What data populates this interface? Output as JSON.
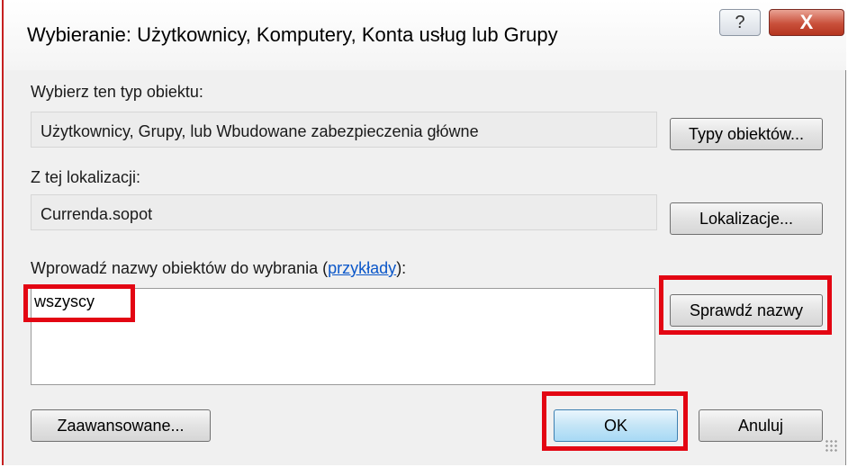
{
  "dialog": {
    "title": "Wybieranie: Użytkownicy, Komputery, Konta usług lub Grupy",
    "help_glyph": "?",
    "close_glyph": "X"
  },
  "object_type": {
    "label": "Wybierz ten typ obiektu:",
    "value": "Użytkownicy, Grupy, lub Wbudowane zabezpieczenia główne",
    "button": "Typy obiektów..."
  },
  "location": {
    "label": "Z tej lokalizacji:",
    "value": "Currenda.sopot",
    "button": "Lokalizacje..."
  },
  "names": {
    "label_prefix": "Wprowadź nazwy obiektów do wybrania (",
    "examples_link": "przykłady",
    "label_suffix": "):",
    "value": "wszyscy",
    "check_button": "Sprawdź nazwy"
  },
  "footer": {
    "advanced_button": "Zaawansowane...",
    "ok_button": "OK",
    "cancel_button": "Anuluj"
  },
  "colors": {
    "highlight": "#e30613",
    "close_button": "#c9503b",
    "link": "#0b57c9"
  },
  "icons": {
    "help": "help-icon",
    "close": "close-icon",
    "resize": "resize-grip-icon"
  }
}
